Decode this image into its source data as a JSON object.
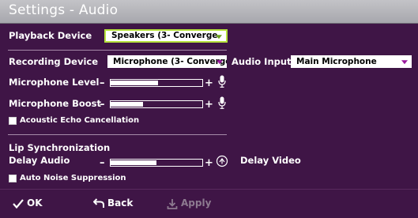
{
  "window": {
    "title": "Settings - Audio"
  },
  "playback": {
    "label": "Playback Device",
    "device": "Speakers (3- Converge"
  },
  "recording": {
    "label": "Recording Device",
    "device": "Microphone (3- Converge",
    "input_label": "Audio Input",
    "input_value": "Main Microphone"
  },
  "mic_level": {
    "label": "Microphone Level",
    "minus": "–",
    "plus": "+",
    "value": 0.52
  },
  "mic_boost": {
    "label": "Microphone Boost",
    "minus": "–",
    "plus": "+",
    "value": 0.35
  },
  "echo": {
    "label": "Acoustic Echo Cancellation",
    "checked": false
  },
  "lipsync": {
    "heading": "Lip Synchronization",
    "label": "Delay Audio",
    "minus": "–",
    "plus": "+",
    "value": 0.5,
    "video_label": "Delay Video"
  },
  "noise": {
    "label": "Auto Noise Suppression",
    "checked": false
  },
  "footer": {
    "ok": "OK",
    "back": "Back",
    "apply": "Apply"
  },
  "colors": {
    "background": "#3f1546",
    "titlebar": "#b3b3b8",
    "select_highlight": "#b6e23d",
    "arrow": "#9a1a9e"
  },
  "icons": [
    "microphone-icon",
    "sync-icon",
    "checkmark-icon",
    "back-arrow-icon",
    "apply-icon",
    "dropdown-arrow-icon"
  ]
}
